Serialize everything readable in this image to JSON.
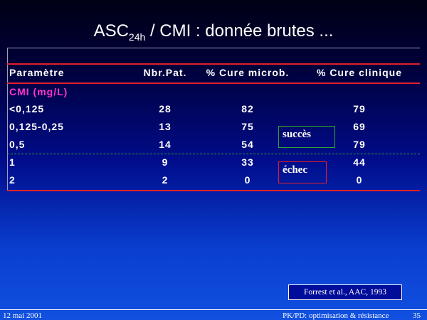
{
  "slide": {
    "title_main": "ASC",
    "title_sub": "24h",
    "title_rest": " / CMI : donnée brutes ..."
  },
  "table": {
    "headers": [
      "Paramètre",
      "Nbr.Pat.",
      "% Cure microb.",
      "% Cure clinique"
    ],
    "section_label": "CMI (mg/L)",
    "rows": [
      [
        "<0,125",
        "28",
        "82",
        "79"
      ],
      [
        "0,125-0,25",
        "13",
        "75",
        "69"
      ],
      [
        "0,5",
        "14",
        "54",
        "79"
      ],
      [
        "1",
        "9",
        "33",
        "44"
      ],
      [
        "2",
        "2",
        "0",
        "0"
      ]
    ]
  },
  "labels": {
    "success": "succès",
    "failure": "échec"
  },
  "citation": "Forrest et al., AAC, 1993",
  "footer": {
    "date": "12 mai 2001",
    "topic": "PK/PD: optimisation & résistance",
    "page": "35"
  },
  "colors": {
    "rule_red": "#e0202a",
    "dash_green": "#2ea82e",
    "section_magenta": "#ff33cc"
  }
}
